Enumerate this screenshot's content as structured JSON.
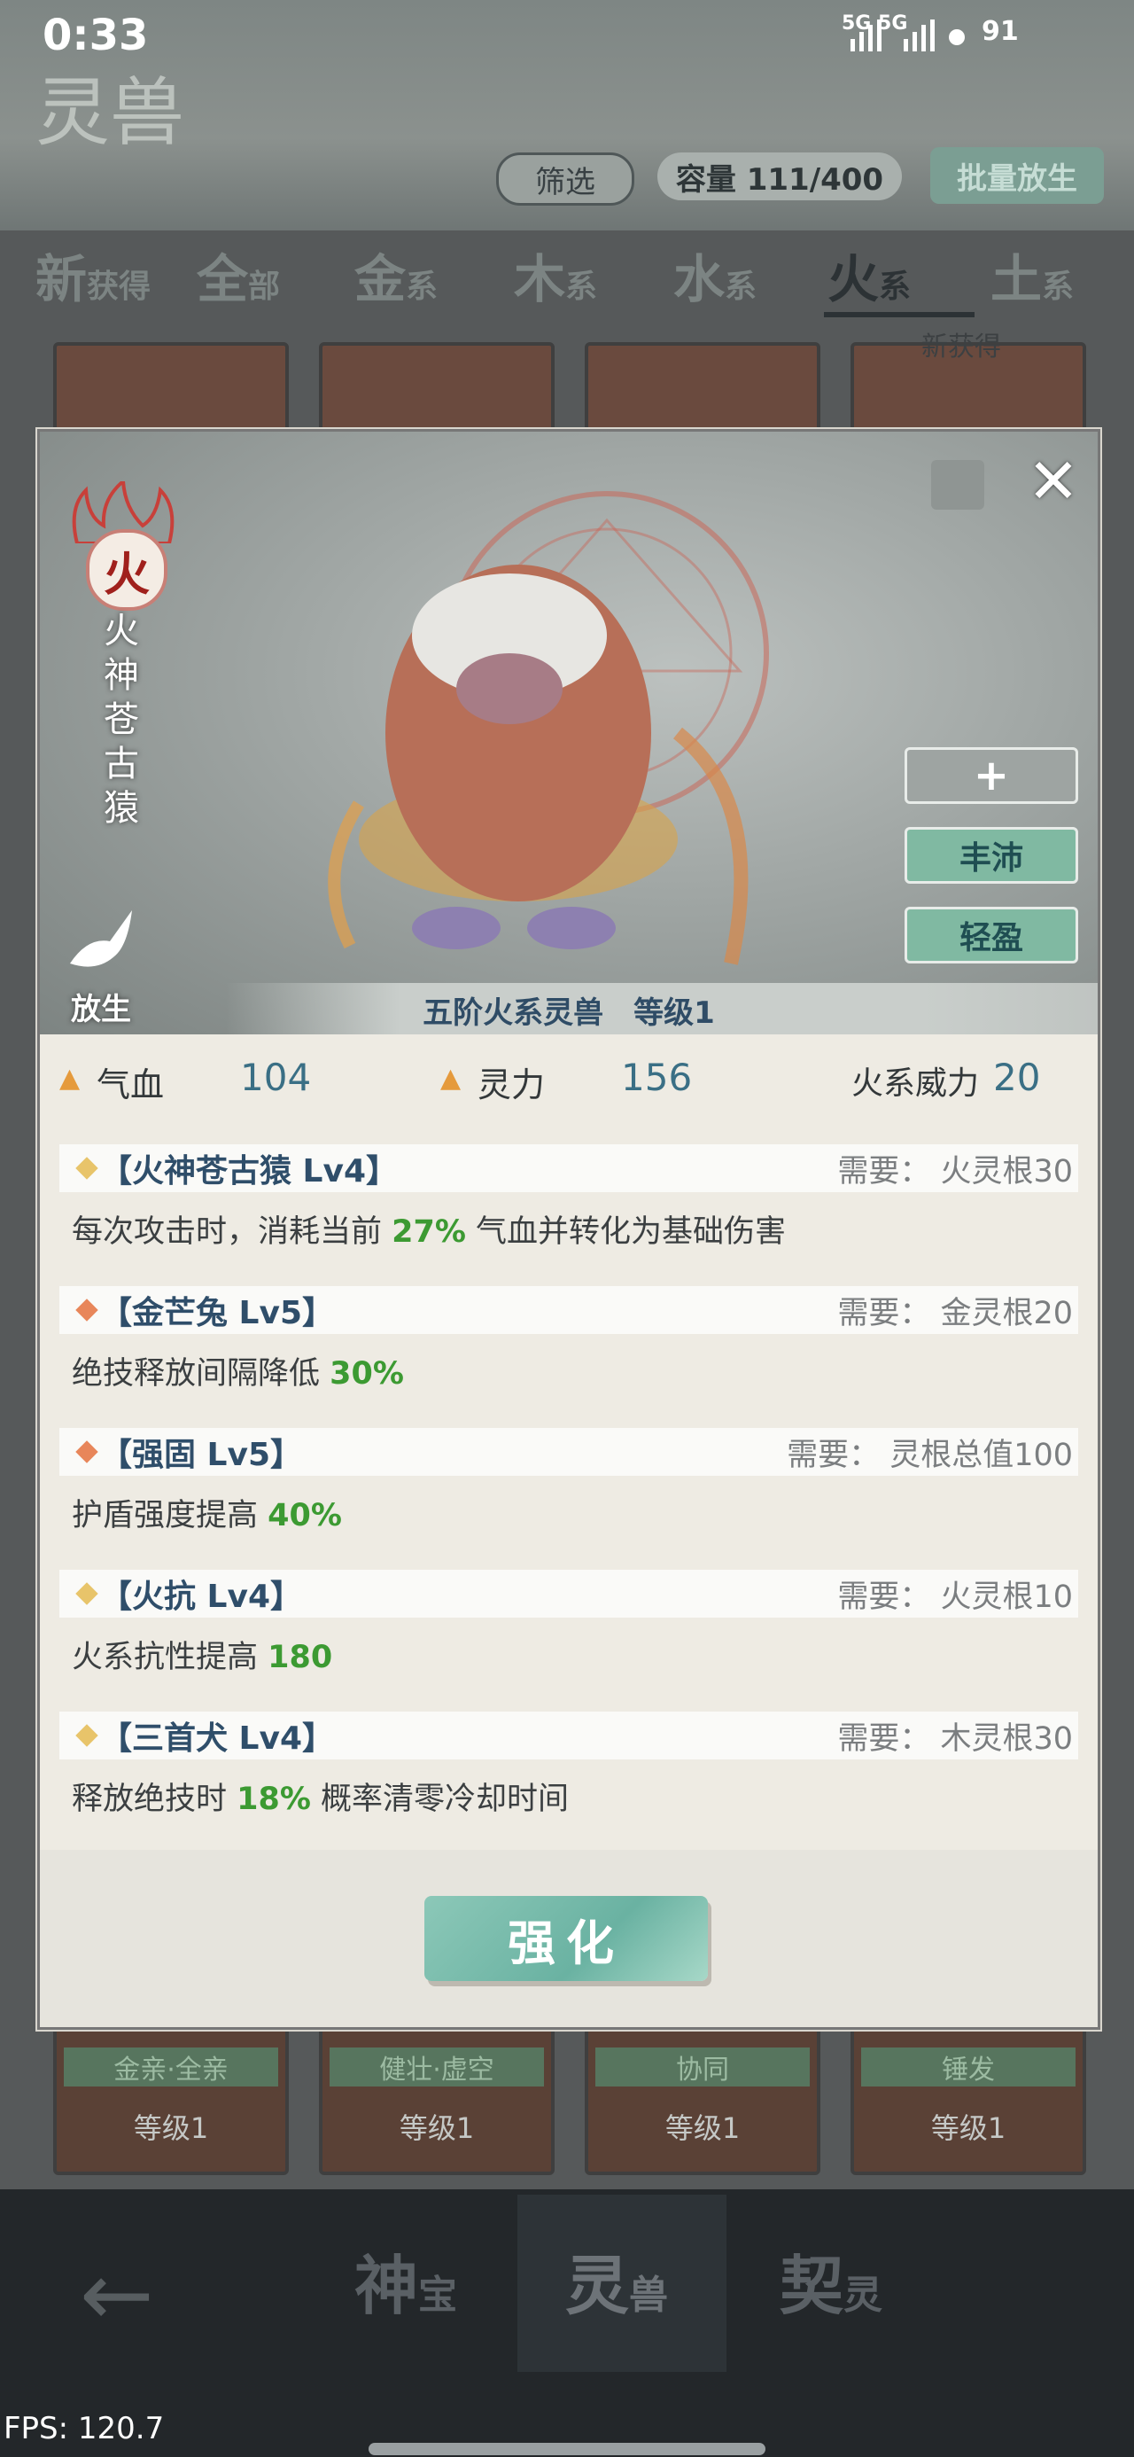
{
  "status_bar": {
    "time": "0:33",
    "network": "5G  5G",
    "battery": "91"
  },
  "header": {
    "logo_text": "灵兽",
    "filter_label": "筛选",
    "capacity_label": "容量 111/400",
    "bulk_release_label": "批量放生"
  },
  "tabs": [
    {
      "main": "新",
      "sub": "获得"
    },
    {
      "main": "全",
      "sub": "部"
    },
    {
      "main": "金",
      "sub": "系"
    },
    {
      "main": "木",
      "sub": "系"
    },
    {
      "main": "水",
      "sub": "系"
    },
    {
      "main": "火",
      "sub": "系",
      "active": true
    },
    {
      "main": "土",
      "sub": "系"
    }
  ],
  "new_tag": "新获得",
  "bottom_cards": [
    {
      "name": "金亲·全亲",
      "level": "等级1"
    },
    {
      "name": "健壮·虚空",
      "level": "等级1"
    },
    {
      "name": "协同",
      "level": "等级1"
    },
    {
      "name": "锤发",
      "level": "等级1"
    }
  ],
  "dialog": {
    "element": "火",
    "beast_name": "火神苍古猿",
    "release_label": "放生",
    "caption": "五阶火系灵兽　等级1",
    "side_buttons": {
      "plus": "+",
      "a": "丰沛",
      "b": "轻盈"
    },
    "stats": {
      "hp_label": "气血",
      "hp_value": "104",
      "spirit_label": "灵力",
      "spirit_value": "156",
      "power_label": "火系威力",
      "power_value": "20"
    },
    "skills": [
      {
        "title": "【火神苍古猿 Lv4】",
        "req": "需要：  火灵根30",
        "desc_pre": "每次攻击时，消耗当前 ",
        "desc_hl": "27%",
        "desc_post": " 气血并转化为基础伤害",
        "diamond_color": "#e8c46a"
      },
      {
        "title": "【金芒兔 Lv5】",
        "req": "需要：  金灵根20",
        "desc_pre": "绝技释放间隔降低 ",
        "desc_hl": "30%",
        "desc_post": "",
        "diamond_color": "#e8865a"
      },
      {
        "title": "【强固 Lv5】",
        "req": "需要：  灵根总值100",
        "desc_pre": "护盾强度提高 ",
        "desc_hl": "40%",
        "desc_post": "",
        "diamond_color": "#e8865a"
      },
      {
        "title": "【火抗 Lv4】",
        "req": "需要：  火灵根10",
        "desc_pre": "火系抗性提高 ",
        "desc_hl": "180",
        "desc_post": "",
        "diamond_color": "#e8c46a"
      },
      {
        "title": "【三首犬 Lv4】",
        "req": "需要：  木灵根30",
        "desc_pre": "释放绝技时 ",
        "desc_hl": "18%",
        "desc_post": " 概率清零冷却时间",
        "diamond_color": "#e8c46a"
      }
    ],
    "upgrade_label": "强化"
  },
  "bottom_nav": [
    {
      "main": "神",
      "sub": "宝"
    },
    {
      "main": "灵",
      "sub": "兽",
      "active": true
    },
    {
      "main": "契",
      "sub": "灵"
    }
  ],
  "fps": "FPS: 120.7"
}
